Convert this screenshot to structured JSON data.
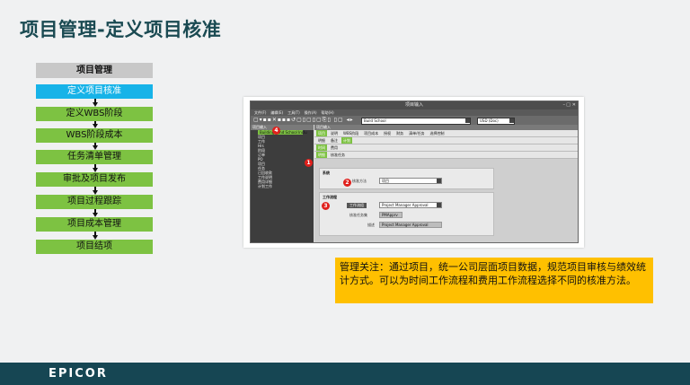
{
  "slide": {
    "title": "项目管理-定义项目核准",
    "note": "管理关注：通过项目，统一公司层面项目数据，规范项目审核与绩效统计方式。可以为时间工作流程和费用工作流程选择不同的核准方法。",
    "logo": "epicor",
    "colors": {
      "accent_green": "#7dc242",
      "accent_blue": "#17b3e8",
      "note_yellow": "#ffc000",
      "footer": "#164653"
    }
  },
  "flow": {
    "header": "项目管理",
    "steps": [
      {
        "label": "定义项目核准",
        "active": true
      },
      {
        "label": "定义WBS阶段",
        "active": false
      },
      {
        "label": "WBS阶段成本",
        "active": false
      },
      {
        "label": "任务清单管理",
        "active": false
      },
      {
        "label": "审批及项目发布",
        "active": false
      },
      {
        "label": "项目过程跟踪",
        "active": false
      },
      {
        "label": "项目成本管理",
        "active": false
      },
      {
        "label": "项目结项",
        "active": false
      }
    ]
  },
  "app": {
    "window_title": "项目输入",
    "menu": [
      "文件(F)",
      "编辑(E)",
      "工具(T)",
      "操作(A)",
      "帮助(H)"
    ],
    "project_combo": "Build School",
    "currency_combo": "USD (Doc)",
    "tree_header": "项目输入",
    "tree_items": [
      "Building Land School Inclu",
      "项目",
      "工作",
      "Hrs",
      "阶段",
      "订单",
      "PO",
      "项目",
      "任务",
      "已回收款",
      "工作说明",
      "费用详细",
      "计划工作"
    ],
    "selected_tree_item": "Building Land School Inclu",
    "main_header": "项目输入",
    "tab_rows": [
      {
        "tabs": [
          "项目",
          "说明",
          "WBS阶段",
          "项目成本",
          "授权",
          "财务",
          "清单/任务",
          "选择控制"
        ],
        "on": 0
      },
      {
        "tabs": [
          "明细",
          "备注",
          "计划"
        ],
        "on": 2
      },
      {
        "tabs": [
          "时间",
          "费用"
        ],
        "on": 0
      },
      {
        "tabs": [
          "明细",
          "核准任务"
        ],
        "on": 0
      }
    ],
    "section_basic": "系统",
    "approval_label": "核准方法",
    "approval_value": "项目",
    "section_workflow": "工作流程",
    "workflow_label": "工作流组",
    "workflow_value": "Project Manager Approval",
    "task_set_label": "核准任务集",
    "task_set_value": "PMApprv",
    "desc_label": "描述",
    "desc_value": "Project Manager Approval",
    "badges": [
      "1",
      "2",
      "3",
      "4"
    ]
  }
}
